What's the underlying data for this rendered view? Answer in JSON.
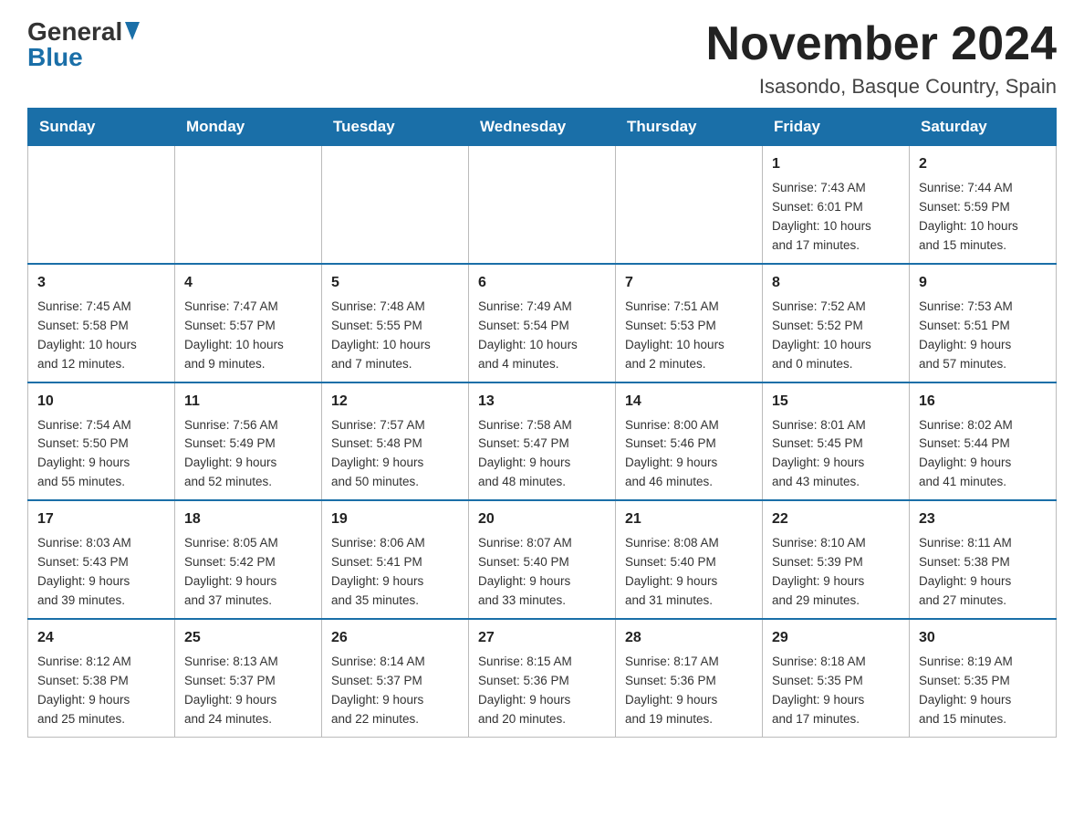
{
  "header": {
    "logo_general": "General",
    "logo_blue": "Blue",
    "title": "November 2024",
    "subtitle": "Isasondo, Basque Country, Spain"
  },
  "days_of_week": [
    "Sunday",
    "Monday",
    "Tuesday",
    "Wednesday",
    "Thursday",
    "Friday",
    "Saturday"
  ],
  "weeks": [
    {
      "days": [
        {
          "number": "",
          "info": ""
        },
        {
          "number": "",
          "info": ""
        },
        {
          "number": "",
          "info": ""
        },
        {
          "number": "",
          "info": ""
        },
        {
          "number": "",
          "info": ""
        },
        {
          "number": "1",
          "info": "Sunrise: 7:43 AM\nSunset: 6:01 PM\nDaylight: 10 hours\nand 17 minutes."
        },
        {
          "number": "2",
          "info": "Sunrise: 7:44 AM\nSunset: 5:59 PM\nDaylight: 10 hours\nand 15 minutes."
        }
      ]
    },
    {
      "days": [
        {
          "number": "3",
          "info": "Sunrise: 7:45 AM\nSunset: 5:58 PM\nDaylight: 10 hours\nand 12 minutes."
        },
        {
          "number": "4",
          "info": "Sunrise: 7:47 AM\nSunset: 5:57 PM\nDaylight: 10 hours\nand 9 minutes."
        },
        {
          "number": "5",
          "info": "Sunrise: 7:48 AM\nSunset: 5:55 PM\nDaylight: 10 hours\nand 7 minutes."
        },
        {
          "number": "6",
          "info": "Sunrise: 7:49 AM\nSunset: 5:54 PM\nDaylight: 10 hours\nand 4 minutes."
        },
        {
          "number": "7",
          "info": "Sunrise: 7:51 AM\nSunset: 5:53 PM\nDaylight: 10 hours\nand 2 minutes."
        },
        {
          "number": "8",
          "info": "Sunrise: 7:52 AM\nSunset: 5:52 PM\nDaylight: 10 hours\nand 0 minutes."
        },
        {
          "number": "9",
          "info": "Sunrise: 7:53 AM\nSunset: 5:51 PM\nDaylight: 9 hours\nand 57 minutes."
        }
      ]
    },
    {
      "days": [
        {
          "number": "10",
          "info": "Sunrise: 7:54 AM\nSunset: 5:50 PM\nDaylight: 9 hours\nand 55 minutes."
        },
        {
          "number": "11",
          "info": "Sunrise: 7:56 AM\nSunset: 5:49 PM\nDaylight: 9 hours\nand 52 minutes."
        },
        {
          "number": "12",
          "info": "Sunrise: 7:57 AM\nSunset: 5:48 PM\nDaylight: 9 hours\nand 50 minutes."
        },
        {
          "number": "13",
          "info": "Sunrise: 7:58 AM\nSunset: 5:47 PM\nDaylight: 9 hours\nand 48 minutes."
        },
        {
          "number": "14",
          "info": "Sunrise: 8:00 AM\nSunset: 5:46 PM\nDaylight: 9 hours\nand 46 minutes."
        },
        {
          "number": "15",
          "info": "Sunrise: 8:01 AM\nSunset: 5:45 PM\nDaylight: 9 hours\nand 43 minutes."
        },
        {
          "number": "16",
          "info": "Sunrise: 8:02 AM\nSunset: 5:44 PM\nDaylight: 9 hours\nand 41 minutes."
        }
      ]
    },
    {
      "days": [
        {
          "number": "17",
          "info": "Sunrise: 8:03 AM\nSunset: 5:43 PM\nDaylight: 9 hours\nand 39 minutes."
        },
        {
          "number": "18",
          "info": "Sunrise: 8:05 AM\nSunset: 5:42 PM\nDaylight: 9 hours\nand 37 minutes."
        },
        {
          "number": "19",
          "info": "Sunrise: 8:06 AM\nSunset: 5:41 PM\nDaylight: 9 hours\nand 35 minutes."
        },
        {
          "number": "20",
          "info": "Sunrise: 8:07 AM\nSunset: 5:40 PM\nDaylight: 9 hours\nand 33 minutes."
        },
        {
          "number": "21",
          "info": "Sunrise: 8:08 AM\nSunset: 5:40 PM\nDaylight: 9 hours\nand 31 minutes."
        },
        {
          "number": "22",
          "info": "Sunrise: 8:10 AM\nSunset: 5:39 PM\nDaylight: 9 hours\nand 29 minutes."
        },
        {
          "number": "23",
          "info": "Sunrise: 8:11 AM\nSunset: 5:38 PM\nDaylight: 9 hours\nand 27 minutes."
        }
      ]
    },
    {
      "days": [
        {
          "number": "24",
          "info": "Sunrise: 8:12 AM\nSunset: 5:38 PM\nDaylight: 9 hours\nand 25 minutes."
        },
        {
          "number": "25",
          "info": "Sunrise: 8:13 AM\nSunset: 5:37 PM\nDaylight: 9 hours\nand 24 minutes."
        },
        {
          "number": "26",
          "info": "Sunrise: 8:14 AM\nSunset: 5:37 PM\nDaylight: 9 hours\nand 22 minutes."
        },
        {
          "number": "27",
          "info": "Sunrise: 8:15 AM\nSunset: 5:36 PM\nDaylight: 9 hours\nand 20 minutes."
        },
        {
          "number": "28",
          "info": "Sunrise: 8:17 AM\nSunset: 5:36 PM\nDaylight: 9 hours\nand 19 minutes."
        },
        {
          "number": "29",
          "info": "Sunrise: 8:18 AM\nSunset: 5:35 PM\nDaylight: 9 hours\nand 17 minutes."
        },
        {
          "number": "30",
          "info": "Sunrise: 8:19 AM\nSunset: 5:35 PM\nDaylight: 9 hours\nand 15 minutes."
        }
      ]
    }
  ]
}
